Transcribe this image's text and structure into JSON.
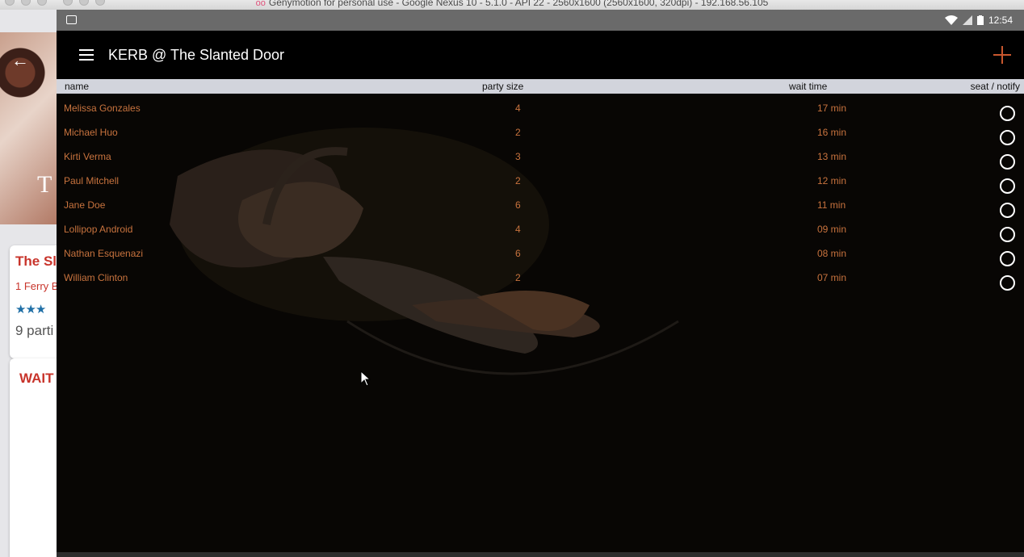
{
  "host_window": {
    "title": "Genymotion for personal use - Google Nexus 10 - 5.1.0 - API 22 - 2560x1600 (2560x1600, 320dpi) - 192.168.56.105",
    "title_glyph": "oo"
  },
  "background_app": {
    "hero_letter": "T",
    "restaurant_name": "The Sl",
    "address": "1 Ferry B",
    "stars": "★★★",
    "parties": "9 parti",
    "waitlist_heading": "WAIT"
  },
  "status_bar": {
    "time": "12:54"
  },
  "app_bar": {
    "title": "KERB @ The Slanted Door"
  },
  "table": {
    "headers": {
      "name": "name",
      "party_size": "party size",
      "wait_time": "wait time",
      "seat_notify": "seat / notify"
    },
    "rows": [
      {
        "name": "Melissa Gonzales",
        "party_size": "4",
        "wait_time": "17 min",
        "seated": false
      },
      {
        "name": "Michael Huo",
        "party_size": "2",
        "wait_time": "16 min",
        "seated": false
      },
      {
        "name": "Kirti Verma",
        "party_size": "3",
        "wait_time": "13 min",
        "seated": false
      },
      {
        "name": "Paul Mitchell",
        "party_size": "2",
        "wait_time": "12 min",
        "seated": false
      },
      {
        "name": "Jane Doe",
        "party_size": "6",
        "wait_time": "11 min",
        "seated": false
      },
      {
        "name": "Lollipop Android",
        "party_size": "4",
        "wait_time": "09 min",
        "seated": false
      },
      {
        "name": "Nathan Esquenazi",
        "party_size": "6",
        "wait_time": "08 min",
        "seated": false
      },
      {
        "name": "William Clinton",
        "party_size": "2",
        "wait_time": "07 min",
        "seated": false
      }
    ]
  },
  "colors": {
    "accent": "#c8733e",
    "add_icon": "#c8572e",
    "brand_red": "#c8342b",
    "header_bg": "#d2d4dc",
    "app_bg": "#080604"
  }
}
